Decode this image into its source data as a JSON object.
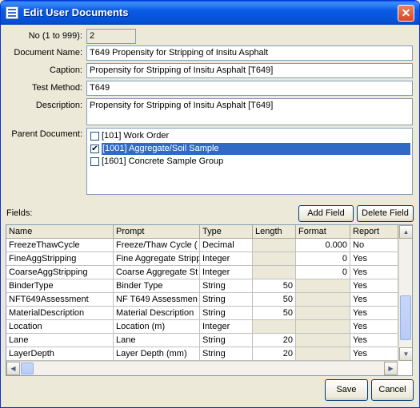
{
  "window": {
    "title": "Edit User Documents",
    "close_glyph": "✕"
  },
  "form": {
    "no_label": "No (1 to 999):",
    "no_value": "2",
    "doc_name_label": "Document Name:",
    "doc_name_value": "T649 Propensity for Stripping of Insitu Asphalt",
    "caption_label": "Caption:",
    "caption_value": "Propensity for Stripping of Insitu Asphalt [T649]",
    "test_method_label": "Test Method:",
    "test_method_value": "T649",
    "description_label": "Description:",
    "description_value": "Propensity for Stripping of Insitu Asphalt [T649]",
    "parent_label": "Parent Document:",
    "parent_items": [
      {
        "label": "[101] Work Order",
        "checked": false,
        "mark": ""
      },
      {
        "label": "[1001] Aggregate/Soil Sample",
        "checked": true,
        "mark": "✔"
      },
      {
        "label": "[1601] Concrete Sample Group",
        "checked": false,
        "mark": ""
      }
    ]
  },
  "fields_section": {
    "label": "Fields:",
    "add_field": "Add Field",
    "delete_field": "Delete Field"
  },
  "grid": {
    "columns": [
      "Name",
      "Prompt",
      "Type",
      "Length",
      "Format",
      "Report"
    ],
    "rows": [
      [
        "FreezeThawCycle",
        "Freeze/Thaw Cycle (",
        "Decimal",
        "",
        "0.000",
        "No"
      ],
      [
        "FineAggStripping",
        "Fine Aggregate Stripp",
        "Integer",
        "",
        "0",
        "Yes"
      ],
      [
        "CoarseAggStripping",
        "Coarse Aggregate St",
        "Integer",
        "",
        "0",
        "Yes"
      ],
      [
        "BinderType",
        "Binder Type",
        "String",
        "50",
        "",
        "Yes"
      ],
      [
        "NFT649Assessment",
        "NF T649 Assessmen",
        "String",
        "50",
        "",
        "Yes"
      ],
      [
        "MaterialDescription",
        "Material Description",
        "String",
        "50",
        "",
        "Yes"
      ],
      [
        "Location",
        "Location (m)",
        "Integer",
        "",
        "",
        "Yes"
      ],
      [
        "Lane",
        "Lane",
        "String",
        "20",
        "",
        "Yes"
      ],
      [
        "LayerDepth",
        "Layer Depth (mm)",
        "String",
        "20",
        "",
        "Yes"
      ]
    ]
  },
  "scroll_glyphs": {
    "up": "▲",
    "down": "▼",
    "left": "◀",
    "right": "▶"
  },
  "buttons": {
    "save": "Save",
    "cancel": "Cancel"
  }
}
